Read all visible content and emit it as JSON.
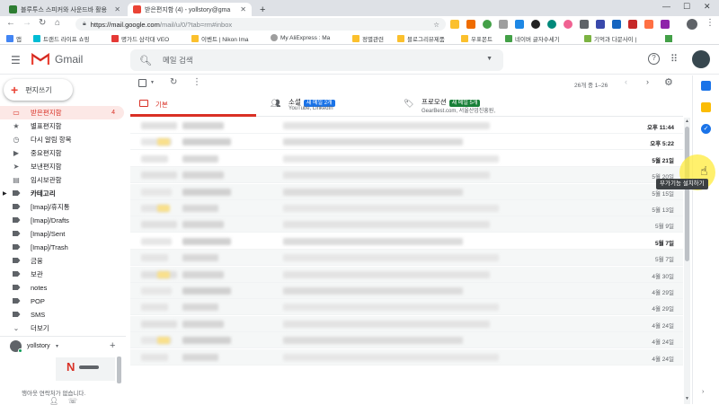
{
  "browser": {
    "tabs": [
      {
        "label": "블루투스 스피커와 사운드바 활용",
        "favicon_color": "#2e7d32"
      },
      {
        "label": "받은편지함 (4) - yollstory@gma",
        "favicon_color": "#ea4335"
      }
    ],
    "new_tab": "+",
    "url_host": "https://mail.google.com",
    "url_path": "/mail/u/0/?tab=rm#inbox",
    "bookmarks": [
      {
        "label": "앱",
        "color": "#4285f4"
      },
      {
        "label": "트랜드 라이프 쇼핑",
        "color": "#00bcd4"
      },
      {
        "label": "명가드 삼각대 VEO",
        "color": "#e53935"
      },
      {
        "label": "이벤트 | Nikon Ima",
        "color": "#fbc02d"
      },
      {
        "label": "My AliExpress : Ma",
        "color": "#9e9e9e"
      },
      {
        "label": "정별관련",
        "color": "#fbc02d"
      },
      {
        "label": "블로그리뷰제품",
        "color": "#fbc02d"
      },
      {
        "label": "우표몬트",
        "color": "#fbc02d"
      },
      {
        "label": "네이버 글자수세기",
        "color": "#43a047"
      },
      {
        "label": "기억과 다문사이 |",
        "color": "#7cb342"
      }
    ]
  },
  "gmail": {
    "logo_text": "Gmail",
    "search_placeholder": "메일 검색",
    "compose_label": "편지쓰기",
    "nav": [
      {
        "label": "받은편지함",
        "count": "4",
        "icon": "inbox-icon"
      },
      {
        "label": "별표편지함",
        "icon": "star-icon"
      },
      {
        "label": "다시 알림 항목",
        "icon": "clock-icon"
      },
      {
        "label": "중요편지함",
        "icon": "important-icon"
      },
      {
        "label": "보낸편지함",
        "icon": "send-icon"
      },
      {
        "label": "임시보관함",
        "icon": "draft-icon"
      },
      {
        "label": "카테고리",
        "icon": "category-icon"
      },
      {
        "label": "[Imap]/휴지통",
        "icon": "label-icon"
      },
      {
        "label": "[Imap]/Drafts",
        "icon": "label-icon"
      },
      {
        "label": "[Imap]/Sent",
        "icon": "label-icon"
      },
      {
        "label": "[Imap]/Trash",
        "icon": "label-icon"
      },
      {
        "label": "금융",
        "icon": "label-icon"
      },
      {
        "label": "보관",
        "icon": "label-icon"
      },
      {
        "label": "notes",
        "icon": "label-icon"
      },
      {
        "label": "POP",
        "icon": "label-icon"
      },
      {
        "label": "SMS",
        "icon": "label-icon"
      },
      {
        "label": "더보기",
        "icon": "chevron-down-icon"
      }
    ],
    "hangouts_user": "yollstory",
    "hangouts_empty": "행아웃 연락처가 없습니다.",
    "pagination": "26개 중 1–26",
    "categories": [
      {
        "label": "기본",
        "subtitle": "",
        "badge": ""
      },
      {
        "label": "소셜",
        "subtitle": "YouTube, LinkedIn",
        "badge": "새 메일 2개",
        "badge_color": "#1a73e8"
      },
      {
        "label": "프로모션",
        "subtitle": "GearBest.com, 서울산업진흥원,",
        "badge": "새 메일 5개",
        "badge_color": "#188038"
      }
    ],
    "dates": [
      "오후 11:44",
      "오후 5:22",
      "5월 21일",
      "5월 20일",
      "5월 15일",
      "5월 13일",
      "5월 9일",
      "5월 7일",
      "5월 7일",
      "4월 30일",
      "4월 29일",
      "4월 29일",
      "4월 24일",
      "4월 24일",
      "4월 24일"
    ],
    "unread_rows": [
      0,
      1,
      2,
      7
    ],
    "tooltip": "부가기능 설치하기"
  }
}
